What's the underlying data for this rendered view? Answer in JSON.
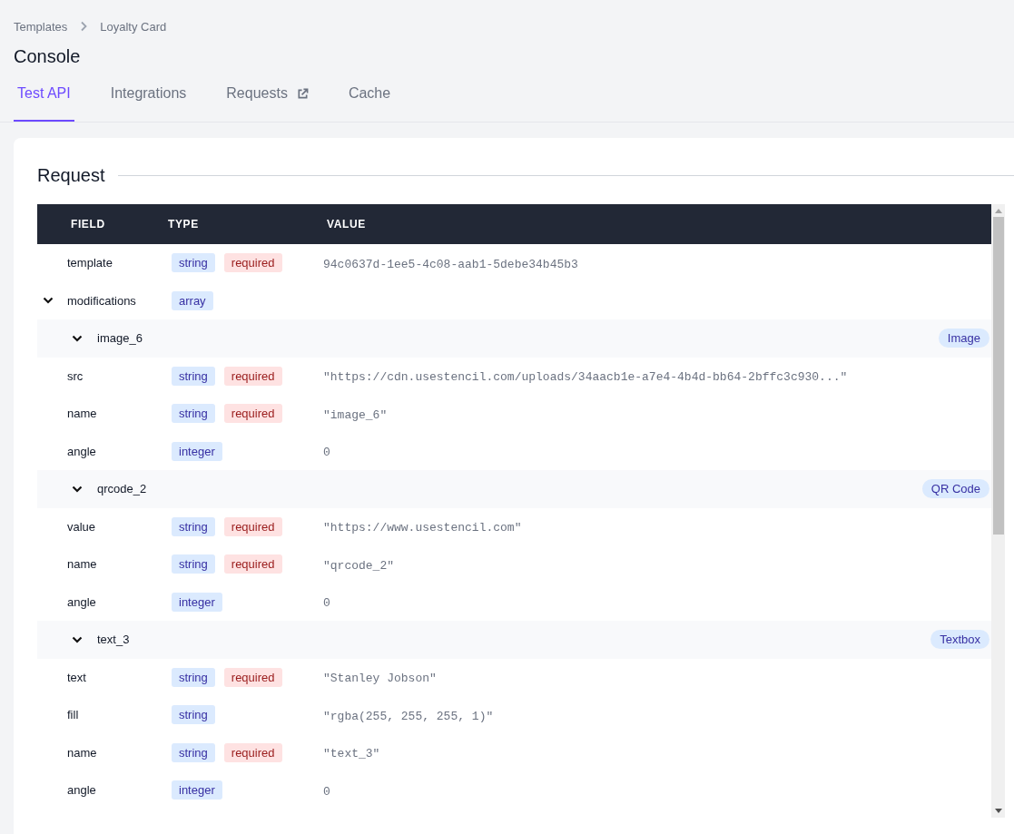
{
  "breadcrumb": [
    "Templates",
    "Loyalty Card"
  ],
  "title": "Console",
  "tabs": [
    {
      "label": "Test API",
      "selected": true,
      "external": false
    },
    {
      "label": "Integrations",
      "selected": false,
      "external": false
    },
    {
      "label": "Requests",
      "selected": false,
      "external": true
    },
    {
      "label": "Cache",
      "selected": false,
      "external": false
    }
  ],
  "section_title": "Request",
  "table": {
    "columns": [
      "FIELD",
      "TYPE",
      "VALUE"
    ],
    "rows": [
      {
        "field": "template",
        "badges": [
          {
            "kind": "type",
            "label": "string"
          },
          {
            "kind": "required",
            "label": "required"
          }
        ],
        "value": "94c0637d-1ee5-4c08-aab1-5debe34b45b3"
      },
      {
        "field": "modifications",
        "badges": [
          {
            "kind": "type",
            "label": "array"
          }
        ],
        "expanded": true,
        "children": [
          {
            "name": "image_6",
            "tag": "Image",
            "expanded": true,
            "fields": [
              {
                "field": "src",
                "badges": [
                  {
                    "kind": "type",
                    "label": "string"
                  },
                  {
                    "kind": "required",
                    "label": "required"
                  }
                ],
                "value": "\"https://cdn.usestencil.com/uploads/34aacb1e-a7e4-4b4d-bb64-2bffc3c930...\""
              },
              {
                "field": "name",
                "badges": [
                  {
                    "kind": "type",
                    "label": "string"
                  },
                  {
                    "kind": "required",
                    "label": "required"
                  }
                ],
                "value": "\"image_6\""
              },
              {
                "field": "angle",
                "badges": [
                  {
                    "kind": "type",
                    "label": "integer"
                  }
                ],
                "value": "0"
              }
            ]
          },
          {
            "name": "qrcode_2",
            "tag": "QR Code",
            "expanded": true,
            "fields": [
              {
                "field": "value",
                "badges": [
                  {
                    "kind": "type",
                    "label": "string"
                  },
                  {
                    "kind": "required",
                    "label": "required"
                  }
                ],
                "value": "\"https://www.usestencil.com\""
              },
              {
                "field": "name",
                "badges": [
                  {
                    "kind": "type",
                    "label": "string"
                  },
                  {
                    "kind": "required",
                    "label": "required"
                  }
                ],
                "value": "\"qrcode_2\""
              },
              {
                "field": "angle",
                "badges": [
                  {
                    "kind": "type",
                    "label": "integer"
                  }
                ],
                "value": "0"
              }
            ]
          },
          {
            "name": "text_3",
            "tag": "Textbox",
            "expanded": true,
            "fields": [
              {
                "field": "text",
                "badges": [
                  {
                    "kind": "type",
                    "label": "string"
                  },
                  {
                    "kind": "required",
                    "label": "required"
                  }
                ],
                "value": "\"Stanley Jobson\""
              },
              {
                "field": "fill",
                "badges": [
                  {
                    "kind": "type",
                    "label": "string"
                  }
                ],
                "value": "\"rgba(255, 255, 255, 1)\""
              },
              {
                "field": "name",
                "badges": [
                  {
                    "kind": "type",
                    "label": "string"
                  },
                  {
                    "kind": "required",
                    "label": "required"
                  }
                ],
                "value": "\"text_3\""
              },
              {
                "field": "angle",
                "badges": [
                  {
                    "kind": "type",
                    "label": "integer"
                  }
                ],
                "value": "0"
              }
            ]
          }
        ]
      }
    ]
  }
}
